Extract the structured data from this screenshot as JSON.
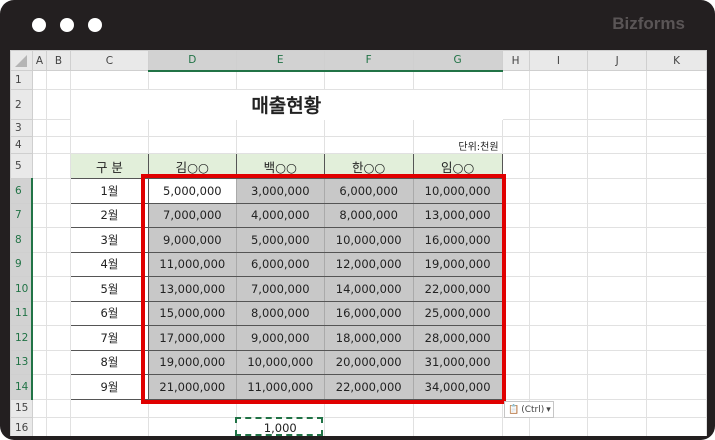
{
  "window": {
    "brand": "Bizforms"
  },
  "columns": [
    "A",
    "B",
    "C",
    "D",
    "E",
    "F",
    "G",
    "H",
    "I",
    "J",
    "K"
  ],
  "rows": [
    "1",
    "2",
    "3",
    "4",
    "5",
    "6",
    "7",
    "8",
    "9",
    "10",
    "11",
    "12",
    "13",
    "14",
    "15",
    "16"
  ],
  "sheet": {
    "title": "매출현황",
    "unit": "단위:천원",
    "header_label": "구  분",
    "people": [
      "김○○",
      "백○○",
      "한○○",
      "임○○"
    ],
    "months": [
      "1월",
      "2월",
      "3월",
      "4월",
      "5월",
      "6월",
      "7월",
      "8월",
      "9월"
    ],
    "values": [
      [
        "5,000,000",
        "3,000,000",
        "6,000,000",
        "10,000,000"
      ],
      [
        "7,000,000",
        "4,000,000",
        "8,000,000",
        "13,000,000"
      ],
      [
        "9,000,000",
        "5,000,000",
        "10,000,000",
        "16,000,000"
      ],
      [
        "11,000,000",
        "6,000,000",
        "12,000,000",
        "19,000,000"
      ],
      [
        "13,000,000",
        "7,000,000",
        "14,000,000",
        "22,000,000"
      ],
      [
        "15,000,000",
        "8,000,000",
        "16,000,000",
        "25,000,000"
      ],
      [
        "17,000,000",
        "9,000,000",
        "18,000,000",
        "28,000,000"
      ],
      [
        "19,000,000",
        "10,000,000",
        "20,000,000",
        "31,000,000"
      ],
      [
        "21,000,000",
        "11,000,000",
        "22,000,000",
        "34,000,000"
      ]
    ],
    "copied_value": "1,000"
  },
  "paste_options": {
    "label": "(Ctrl)"
  },
  "colors": {
    "highlight": "#e00000",
    "header_fill": "#e2efda",
    "selection_fill": "#c8c8c8"
  }
}
